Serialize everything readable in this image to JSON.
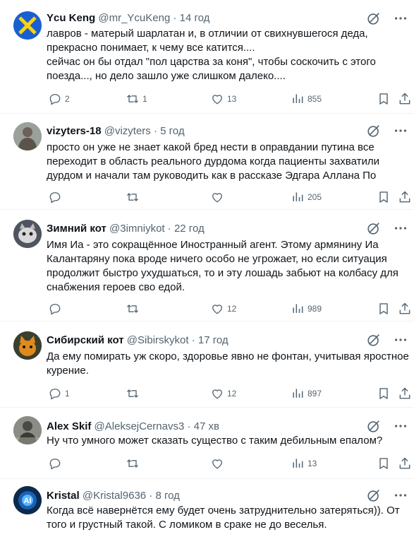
{
  "posts": [
    {
      "name": "Ycu Keng",
      "handle": "@mr_YcuKeng",
      "sep": " · ",
      "time": "14 год",
      "text": "лавров - матерый шарлатан и, в отличии от свихнувшегося деда,\nпрекрасно понимает, к чему все катится....\nсейчас он бы отдал \"пол царства за коня\", чтобы соскочить с этого\nпоезда..., но дело зашло уже слишком далеко....",
      "replies": "2",
      "reposts": "1",
      "likes": "13",
      "views": "855"
    },
    {
      "name": "vizyters-18",
      "handle": "@vizyters",
      "sep": " · ",
      "time": "5 год",
      "text": "просто он уже не знает какой бред нести в оправдании путина все\nпереходит в область реального дурдома когда пациенты захватили\nдурдом и начали там руководить как в рассказе Эдгара Аллана По",
      "replies": "",
      "reposts": "",
      "likes": "",
      "views": "205"
    },
    {
      "name": "Зимний кот",
      "handle": "@3imniykot",
      "sep": " · ",
      "time": "22 год",
      "text": "Имя Иа - это сокращённое Иностранный агент. Этому армянину Иа\nКалантаряну пока вроде ничего особо не угрожает, но если ситуация\nпродолжит быстро ухудшаться, то и эту лошадь забьют на колбасу для\nснабжения героев сво едой.",
      "replies": "",
      "reposts": "",
      "likes": "12",
      "views": "989"
    },
    {
      "name": "Сибирский кот",
      "handle": "@Sibirskykot",
      "sep": " · ",
      "time": "17 год",
      "text": "Да ему помирать уж скоро, здоровье явно не фонтан, учитывая яростное\nкурение.",
      "replies": "1",
      "reposts": "",
      "likes": "12",
      "views": "897"
    },
    {
      "name": "Alex Skif",
      "handle": "@AleksejCernavs3",
      "sep": " · ",
      "time": "47 хв",
      "text": "Ну что умного может сказать существо с таким дебильным епалом?",
      "replies": "",
      "reposts": "",
      "likes": "",
      "views": "13"
    },
    {
      "name": "Kristal",
      "handle": "@Kristal9636",
      "sep": " · ",
      "time": "8 год",
      "text": "Когда всё навернётся ему будет очень затруднительно затеряться)). От\nтого и грустный такой. С ломиком в сраке не до веселья.",
      "replies": "",
      "reposts": "",
      "likes": "",
      "views": ""
    }
  ]
}
